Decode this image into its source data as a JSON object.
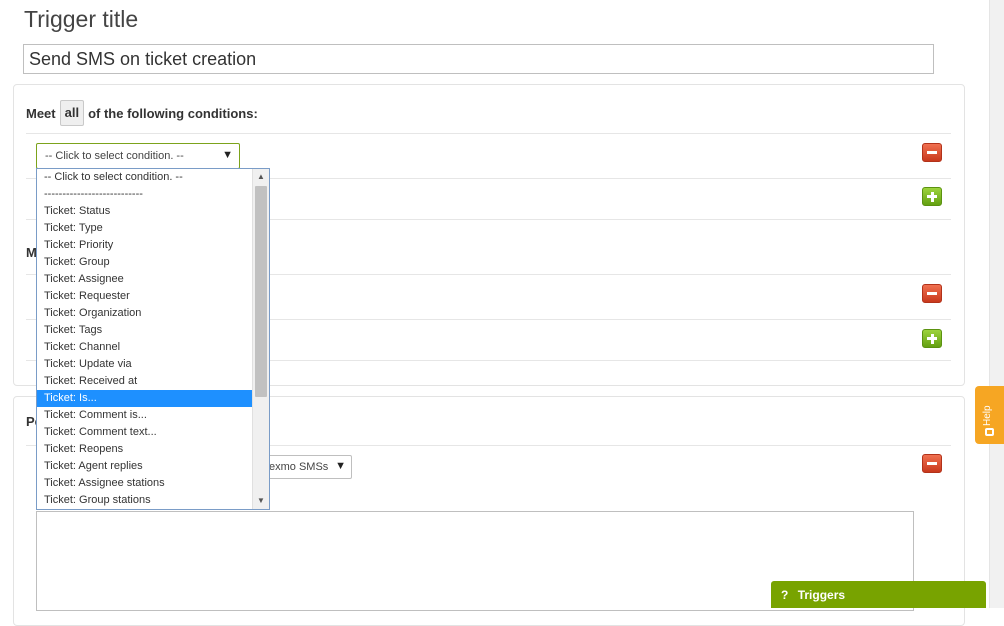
{
  "page": {
    "title_label": "Trigger title",
    "title_value": "Send SMS on ticket creation"
  },
  "conditions": {
    "meet_prefix": "Meet",
    "meet_value": "all",
    "meet_suffix": "of the following conditions:",
    "select_value": "-- Click to select condition. --",
    "second_group_label_partial": "M"
  },
  "dropdown": {
    "options": [
      "-- Click to select condition. --",
      "---------------------------",
      "Ticket: Status",
      "Ticket: Type",
      "Ticket: Priority",
      "Ticket: Group",
      "Ticket: Assignee",
      "Ticket: Requester",
      "Ticket: Organization",
      "Ticket: Tags",
      "Ticket: Channel",
      "Ticket: Update via",
      "Ticket: Received at",
      "Ticket: Is...",
      "Ticket: Comment is...",
      "Ticket: Comment text...",
      "Ticket: Reopens",
      "Ticket: Agent replies",
      "Ticket: Assignee stations",
      "Ticket: Group stations"
    ],
    "selected_index": 13
  },
  "perform": {
    "label_partial": "Pe",
    "action_select_value": "exmo SMSs"
  },
  "help_tab": {
    "label": "Help"
  },
  "triggers_bar": {
    "icon": "?",
    "label": "Triggers"
  },
  "colors": {
    "accent_green": "#78a300",
    "remove_red": "#d2452a",
    "add_green": "#7dbb1f",
    "help_orange": "#f6a623",
    "selected_blue": "#1e90ff"
  }
}
